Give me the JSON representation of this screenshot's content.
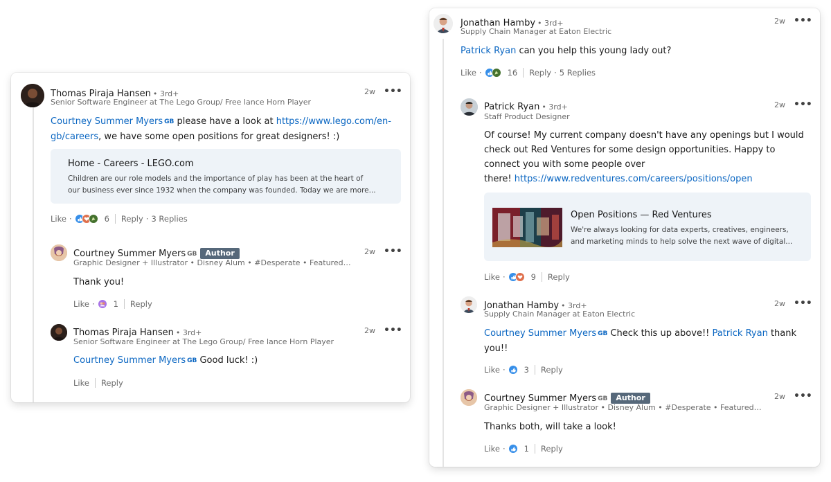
{
  "left_card": {
    "root": {
      "name": "Thomas Piraja Hansen",
      "degree": "• 3rd+",
      "headline": "Senior Software Engineer at The Lego Group/ Free lance Horn Player",
      "time": "2w",
      "mention": "Courtney Summer Myers",
      "mention_badge": "GB",
      "text_part1": " please have a look at ",
      "link": "https://www.lego.com/en-gb/careers",
      "text_part2": ", we have some open positions for great designers! :)",
      "preview": {
        "title": "Home - Careers - LEGO.com",
        "desc_line1": "Children are our role models and the importance of play has been at the heart of",
        "desc_line2": "our business ever since 1932 when the company was founded. Today we are more..."
      },
      "like": "Like",
      "react_count": "6",
      "reply": "Reply",
      "replies": "3 Replies"
    },
    "reply1": {
      "name": "Courtney Summer Myers",
      "name_badge": "GB",
      "author": "Author",
      "headline": "Graphic Designer + Illustrator • Disney Alum • #Desperate • Featured i...",
      "time": "2w",
      "text": "Thank you!",
      "like": "Like",
      "react_count": "1",
      "reply": "Reply"
    },
    "reply2": {
      "name": "Thomas Piraja Hansen",
      "degree": "• 3rd+",
      "headline": "Senior Software Engineer at The Lego Group/ Free lance Horn Player",
      "time": "2w",
      "mention": "Courtney Summer Myers",
      "mention_badge": "GB",
      "text": " Good luck! :)",
      "like": "Like",
      "reply": "Reply"
    }
  },
  "right_card": {
    "root": {
      "name": "Jonathan Hamby",
      "degree": "• 3rd+",
      "headline": "Supply Chain Manager at Eaton Electric",
      "time": "2w",
      "mention": "Patrick Ryan",
      "text": " can you help this young lady out?",
      "like": "Like",
      "react_count": "16",
      "reply": "Reply",
      "replies": "5 Replies"
    },
    "reply1": {
      "name": "Patrick Ryan",
      "degree": "• 3rd+",
      "headline": "Staff Product Designer",
      "time": "2w",
      "line1": "Of course! My current company doesn't have any openings but I would",
      "line2": "check out Red Ventures for some design opportunities. Happy to",
      "line3": "connect you with some people over",
      "line4_prefix": "there! ",
      "link": "https://www.redventures.com/careers/positions/open",
      "preview": {
        "title": "Open Positions — Red Ventures",
        "desc_line1": "We're always looking for data experts, creatives, engineers,",
        "desc_line2": "and marketing minds to help solve the next wave of digital..."
      },
      "like": "Like",
      "react_count": "9",
      "reply": "Reply"
    },
    "reply2": {
      "name": "Jonathan Hamby",
      "degree": "• 3rd+",
      "headline": "Supply Chain Manager at Eaton Electric",
      "time": "2w",
      "mention1": "Courtney Summer Myers",
      "mention1_badge": "GB",
      "text1": " Check this up above!! ",
      "mention2": "Patrick Ryan",
      "text2": " thank",
      "text3": "you!!",
      "like": "Like",
      "react_count": "3",
      "reply": "Reply"
    },
    "reply3": {
      "name": "Courtney Summer Myers",
      "name_badge": "GB",
      "author": "Author",
      "headline": "Graphic Designer + Illustrator • Disney Alum • #Desperate • Featured i...",
      "time": "2w",
      "text": "Thanks both, will take a look!",
      "like": "Like",
      "react_count": "1",
      "reply": "Reply"
    }
  },
  "ui": {
    "more_glyph": "•••",
    "dot": "·"
  },
  "colors": {
    "link": "#0a66c2",
    "author_badge": "#56687a",
    "preview_bg": "#eef3f8",
    "like_react": "#378fe9",
    "celebrate_react": "#44712e",
    "love_react": "#df704d"
  }
}
